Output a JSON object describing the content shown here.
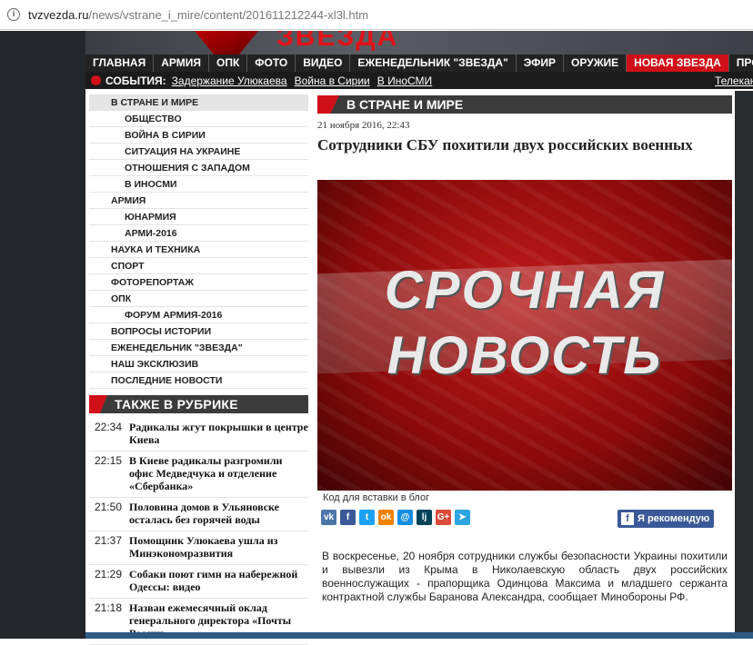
{
  "browser": {
    "url_domain": "tvzvezda.ru",
    "url_path": "/news/vstrane_i_mire/content/201611212244-xl3l.htm"
  },
  "site": {
    "logo": "ЗВЕЗДА",
    "nav": [
      "ГЛАВНАЯ",
      "АРМИЯ",
      "ОПК",
      "ФОТО",
      "ВИДЕО",
      "ЕЖЕНЕДЕЛЬНИК \"ЗВЕЗДА\"",
      "ЭФИР",
      "ОРУЖИЕ",
      "НОВАЯ ЗВЕЗДА",
      "ПРО"
    ],
    "events_label": "СОБЫТИЯ:",
    "events": [
      "Задержание Улюкаева",
      "Война в Сирии",
      "В ИноСМИ"
    ],
    "events_right": "Телекан"
  },
  "sidebar": {
    "items": [
      {
        "label": "В СТРАНЕ И МИРЕ",
        "sub": false,
        "active": true
      },
      {
        "label": "ОБЩЕСТВО",
        "sub": true
      },
      {
        "label": "ВОЙНА В СИРИИ",
        "sub": true
      },
      {
        "label": "СИТУАЦИЯ НА УКРАИНЕ",
        "sub": true
      },
      {
        "label": "ОТНОШЕНИЯ С ЗАПАДОМ",
        "sub": true
      },
      {
        "label": "В ИНОСМИ",
        "sub": true
      },
      {
        "label": "АРМИЯ",
        "sub": false
      },
      {
        "label": "ЮНАРМИЯ",
        "sub": true
      },
      {
        "label": "АРМИ-2016",
        "sub": true
      },
      {
        "label": "НАУКА И ТЕХНИКА",
        "sub": false
      },
      {
        "label": "СПОРТ",
        "sub": false
      },
      {
        "label": "ФОТОРЕПОРТАЖ",
        "sub": false
      },
      {
        "label": "ОПК",
        "sub": false
      },
      {
        "label": "ФОРУМ АРМИЯ-2016",
        "sub": true
      },
      {
        "label": "ВОПРОСЫ ИСТОРИИ",
        "sub": false
      },
      {
        "label": "ЕЖЕНЕДЕЛЬНИК \"ЗВЕЗДА\"",
        "sub": false
      },
      {
        "label": "НАШ ЭКСКЛЮЗИВ",
        "sub": false
      },
      {
        "label": "ПОСЛЕДНИЕ НОВОСТИ",
        "sub": false
      }
    ],
    "also_title": "ТАКЖЕ В РУБРИКЕ",
    "news": [
      {
        "time": "22:34",
        "headline": "Радикалы жгут покрышки в центре Киева"
      },
      {
        "time": "22:15",
        "headline": "В Киеве радикалы разгромили офис Медведчука и отделение «Сбербанка»"
      },
      {
        "time": "21:50",
        "headline": "Половина домов в Ульяновске осталась без горячей воды"
      },
      {
        "time": "21:37",
        "headline": "Помощник Улюкаева ушла из Минэкономразвития"
      },
      {
        "time": "21:29",
        "headline": "Собаки поют гимн на набережной Одессы: видео"
      },
      {
        "time": "21:18",
        "headline": "Назван ежемесячный оклад генерального директора «Почты России»"
      }
    ]
  },
  "article": {
    "section": "В СТРАНЕ И МИРЕ",
    "date": "21 ноября 2016, 22:43",
    "title": "Сотрудники СБУ похитили двух российских военных",
    "image_line1": "СРОЧНАЯ",
    "image_line2": "НОВОСТЬ",
    "embed_label": "Код для вставки в блог",
    "share": [
      {
        "icon": "vk-icon",
        "glyph": "vk",
        "color": "#4a76a8"
      },
      {
        "icon": "facebook-icon",
        "glyph": "f",
        "color": "#3b5998"
      },
      {
        "icon": "twitter-icon",
        "glyph": "t",
        "color": "#1da1f2"
      },
      {
        "icon": "odnoklassniki-icon",
        "glyph": "ok",
        "color": "#ee8208"
      },
      {
        "icon": "moimir-icon",
        "glyph": "@",
        "color": "#168de2"
      },
      {
        "icon": "livejournal-icon",
        "glyph": "lj",
        "color": "#004359"
      },
      {
        "icon": "googleplus-icon",
        "glyph": "G+",
        "color": "#dd4b39"
      },
      {
        "icon": "telegram-icon",
        "glyph": "➤",
        "color": "#2ca5e0"
      }
    ],
    "recommend_label": "Я рекомендую",
    "body": "В воскресенье, 20 ноября сотрудники службы безопасности Украины похитили и вывезли из Крыма в Николаевскую область двух российских военнослужащих - прапорщика Одинцова Максима и младшего сержанта контрактной службы Баранова Александра, сообщает Минобороны РФ."
  }
}
